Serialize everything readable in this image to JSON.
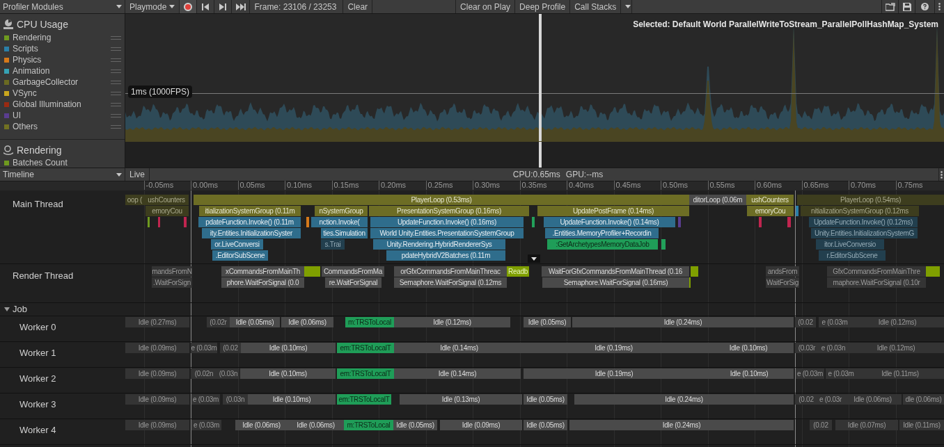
{
  "toolbar": {
    "modules_dropdown": "Profiler Modules",
    "target": "Playmode",
    "recording": true,
    "frame": "Frame: 23106 / 23253",
    "clear": "Clear",
    "options": [
      "Clear on Play",
      "Deep Profile",
      "Call Stacks"
    ]
  },
  "modules": [
    {
      "title": "CPU Usage",
      "series": [
        {
          "name": "Rendering",
          "color": "#6f9a1f"
        },
        {
          "name": "Scripts",
          "color": "#2b7fa8"
        },
        {
          "name": "Physics",
          "color": "#d6791a"
        },
        {
          "name": "Animation",
          "color": "#36a2b5"
        },
        {
          "name": "GarbageCollector",
          "color": "#6b6b22"
        },
        {
          "name": "VSync",
          "color": "#c9a71e"
        },
        {
          "name": "Global Illumination",
          "color": "#9a2a12"
        },
        {
          "name": "UI",
          "color": "#5a3d8f"
        },
        {
          "name": "Others",
          "color": "#717122"
        }
      ]
    },
    {
      "title": "Rendering",
      "series": [
        {
          "name": "Batches Count",
          "color": "#6f9a1f"
        }
      ]
    }
  ],
  "chart": {
    "threshold_label": "1ms (1000FPS)",
    "selected": "Selected: Default World ParallelWriteToStream_ParallelPollHashMap_System"
  },
  "timeline_bar": {
    "view": "Timeline",
    "mode": "Live",
    "cpu": "CPU:0.65ms",
    "gpu": "GPU:--ms"
  },
  "ticks": [
    "-0.05ms",
    "0.00ms",
    "0.05ms",
    "0.10ms",
    "0.15ms",
    "0.20ms",
    "0.25ms",
    "0.30ms",
    "0.35ms",
    "0.40ms",
    "0.45ms",
    "0.50ms",
    "0.55ms",
    "0.60ms",
    "0.65ms",
    "0.70ms",
    "0.75ms"
  ],
  "threads": [
    {
      "name": "Main Thread",
      "blocks": [
        {
          "text": "oop (",
          "kind": "player",
          "dimmed": true
        },
        {
          "text": "ushCounters",
          "kind": "player",
          "dimmed": true
        },
        {
          "text": "PlayerLoop (0.53ms)",
          "kind": "player",
          "dimmed": false
        },
        {
          "text": "ditorLoop (0.06m",
          "kind": "wait",
          "dimmed": false
        },
        {
          "text": "ushCounters",
          "kind": "player",
          "dimmed": false
        },
        {
          "text": "PlayerLoop (0.54ms)",
          "kind": "player",
          "dimmed": true
        },
        {
          "text": "emoryCou",
          "kind": "player",
          "dimmed": true
        },
        {
          "text": "itializationSystemGroup (0.11m",
          "kind": "player",
          "dimmed": false
        },
        {
          "text": "nSystemGroup",
          "kind": "player",
          "dimmed": false
        },
        {
          "text": "PresentationSystemGroup (0.16ms)",
          "kind": "player",
          "dimmed": false
        },
        {
          "text": "UpdatePostFrame (0.14ms)",
          "kind": "player",
          "dimmed": false
        },
        {
          "text": "emoryCou",
          "kind": "player",
          "dimmed": false
        },
        {
          "text": "nitializationSystemGroup (0.12ms",
          "kind": "player",
          "dimmed": true
        },
        {
          "text": "pdateFunction.Invoke() (0.11m",
          "kind": "script",
          "dimmed": false
        },
        {
          "text": "nction.Invoke(",
          "kind": "script",
          "dimmed": false
        },
        {
          "text": "UpdateFunction.Invoke() (0.16ms)",
          "kind": "script",
          "dimmed": false
        },
        {
          "text": "UpdateFunction.Invoke() (0.14ms)",
          "kind": "script",
          "dimmed": false
        },
        {
          "text": "UpdateFunction.Invoke() (0.12ms)",
          "kind": "script",
          "dimmed": true
        },
        {
          "text": "ity.Entities.InitializationSyster",
          "kind": "script",
          "dimmed": false
        },
        {
          "text": "ties.Simulation",
          "kind": "script",
          "dimmed": false
        },
        {
          "text": "World Unity.Entities.PresentationSystemGroup",
          "kind": "script",
          "dimmed": false
        },
        {
          "text": ".Entities.MemoryProfiler+Recordin",
          "kind": "script",
          "dimmed": false
        },
        {
          "text": "Unity.Entities.InitializationSystemG",
          "kind": "script",
          "dimmed": true
        },
        {
          "text": "or.LiveConversi",
          "kind": "script",
          "dimmed": false
        },
        {
          "text": "s.Trai",
          "kind": "script",
          "dimmed": true
        },
        {
          "text": "Unity.Rendering.HybridRendererSys",
          "kind": "script",
          "dimmed": false
        },
        {
          "text": ":GetArchetypesMemoryDataJob",
          "kind": "job",
          "dimmed": false
        },
        {
          "text": "itor.LiveConversio",
          "kind": "script",
          "dimmed": true
        },
        {
          "text": ".EditorSubScene",
          "kind": "script",
          "dimmed": false
        },
        {
          "text": "pdateHybridV2Batches (0.11m",
          "kind": "script",
          "dimmed": false
        },
        {
          "text": "r.EditorSubScene",
          "kind": "script",
          "dimmed": true
        }
      ]
    },
    {
      "name": "Render Thread",
      "blocks": [
        {
          "text": "mandsFromN",
          "kind": "wait",
          "dimmed": true
        },
        {
          "text": "xCommandsFromMainTh",
          "kind": "wait",
          "dimmed": false
        },
        {
          "text": "CommandsFromMa",
          "kind": "wait",
          "dimmed": false
        },
        {
          "text": "orGfxCommandsFromMainThreac",
          "kind": "wait",
          "dimmed": false
        },
        {
          "text": "Readb",
          "kind": "gpu",
          "dimmed": false
        },
        {
          "text": "WaitForGfxCommandsFromMainThread (0.16",
          "kind": "wait",
          "dimmed": false
        },
        {
          "text": "andsFrom",
          "kind": "wait",
          "dimmed": true
        },
        {
          "text": "GfxCommandsFromMainThre",
          "kind": "wait",
          "dimmed": true
        },
        {
          "text": ".WaitForSign",
          "kind": "wait",
          "dimmed": true
        },
        {
          "text": "phore.WaitForSignal (0.0",
          "kind": "wait",
          "dimmed": false
        },
        {
          "text": "re.WaitForSignal",
          "kind": "wait",
          "dimmed": false
        },
        {
          "text": "Semaphore.WaitForSignal (0.12ms",
          "kind": "wait",
          "dimmed": false
        },
        {
          "text": "Semaphore.WaitForSignal (0.16ms)",
          "kind": "wait",
          "dimmed": false
        },
        {
          "text": "WaitForSig",
          "kind": "wait",
          "dimmed": true
        },
        {
          "text": "maphore.WaitForSignal (0.10r",
          "kind": "wait",
          "dimmed": true
        }
      ]
    },
    {
      "name": "Job",
      "expanded": true,
      "children": [
        {
          "name": "Worker 0",
          "blocks": [
            {
              "text": "Idle (0.27ms)",
              "kind": "wait",
              "dimmed": true
            },
            {
              "text": "(0.02r",
              "kind": "wait",
              "dimmed": true
            },
            {
              "text": "Idle (0.05ms)",
              "kind": "wait",
              "dimmed": false
            },
            {
              "text": "Idle (0.06ms)",
              "kind": "wait",
              "dimmed": false
            },
            {
              "text": "m:TRSToLocal",
              "kind": "job",
              "dimmed": false
            },
            {
              "text": "Idle (0.12ms)",
              "kind": "wait",
              "dimmed": false
            },
            {
              "text": "Idle (0.05ms)",
              "kind": "wait",
              "dimmed": false
            },
            {
              "text": "Idle (0.24ms)",
              "kind": "wait",
              "dimmed": false
            },
            {
              "text": "(0.02",
              "kind": "wait",
              "dimmed": true
            },
            {
              "text": "e (0.03m",
              "kind": "wait",
              "dimmed": true
            },
            {
              "text": "Idle (0.12ms)",
              "kind": "wait",
              "dimmed": true
            }
          ]
        },
        {
          "name": "Worker 1",
          "blocks": [
            {
              "text": "Idle (0.09ms)",
              "kind": "wait",
              "dimmed": true
            },
            {
              "text": "e (0.03m",
              "kind": "wait",
              "dimmed": true
            },
            {
              "text": "(0.02",
              "kind": "wait",
              "dimmed": true
            },
            {
              "text": "Idle (0.10ms)",
              "kind": "wait",
              "dimmed": false
            },
            {
              "text": "em:TRSToLocalT",
              "kind": "job",
              "dimmed": false
            },
            {
              "text": "Idle (0.14ms)",
              "kind": "wait",
              "dimmed": false
            },
            {
              "text": "Idle (0.19ms)",
              "kind": "wait",
              "dimmed": false
            },
            {
              "text": "Idle (0.10ms)",
              "kind": "wait",
              "dimmed": false
            },
            {
              "text": "(0.03r",
              "kind": "wait",
              "dimmed": true
            },
            {
              "text": "e (0.03n",
              "kind": "wait",
              "dimmed": true
            },
            {
              "text": "Idle (0.12ms)",
              "kind": "wait",
              "dimmed": true
            }
          ]
        },
        {
          "name": "Worker 2",
          "blocks": [
            {
              "text": "Idle (0.09ms)",
              "kind": "wait",
              "dimmed": true
            },
            {
              "text": "(0.02n",
              "kind": "wait",
              "dimmed": true
            },
            {
              "text": "(0.03n",
              "kind": "wait",
              "dimmed": true
            },
            {
              "text": "Idle (0.10ms)",
              "kind": "wait",
              "dimmed": false
            },
            {
              "text": "em:TRSToLocalT",
              "kind": "job",
              "dimmed": false
            },
            {
              "text": "Idle (0.14ms)",
              "kind": "wait",
              "dimmed": false
            },
            {
              "text": "Idle (0.19ms)",
              "kind": "wait",
              "dimmed": false
            },
            {
              "text": "Idle (0.10ms)",
              "kind": "wait",
              "dimmed": false
            },
            {
              "text": "e (0.03m",
              "kind": "wait",
              "dimmed": true
            },
            {
              "text": "e (0.03m",
              "kind": "wait",
              "dimmed": true
            },
            {
              "text": "Idle (0.11ms)",
              "kind": "wait",
              "dimmed": true
            }
          ]
        },
        {
          "name": "Worker 3",
          "blocks": [
            {
              "text": "Idle (0.09ms)",
              "kind": "wait",
              "dimmed": true
            },
            {
              "text": "e (0.03m",
              "kind": "wait",
              "dimmed": true
            },
            {
              "text": "(0.03n",
              "kind": "wait",
              "dimmed": true
            },
            {
              "text": "Idle (0.10ms)",
              "kind": "wait",
              "dimmed": false
            },
            {
              "text": "em:TRSToLocalT",
              "kind": "job",
              "dimmed": false
            },
            {
              "text": "Idle (0.13ms)",
              "kind": "wait",
              "dimmed": false
            },
            {
              "text": "Idle (0.05ms)",
              "kind": "wait",
              "dimmed": false
            },
            {
              "text": "Idle (0.24ms)",
              "kind": "wait",
              "dimmed": false
            },
            {
              "text": "(0.02",
              "kind": "wait",
              "dimmed": true
            },
            {
              "text": "e (0.03r",
              "kind": "wait",
              "dimmed": true
            },
            {
              "text": "Idle (0.06ms)",
              "kind": "wait",
              "dimmed": true
            },
            {
              "text": "dle (0.06ms)",
              "kind": "wait",
              "dimmed": true
            }
          ]
        },
        {
          "name": "Worker 4",
          "blocks": [
            {
              "text": "Idle (0.09ms)",
              "kind": "wait",
              "dimmed": true
            },
            {
              "text": "e (0.03m",
              "kind": "wait",
              "dimmed": true
            },
            {
              "text": "Idle (0.06ms)",
              "kind": "wait",
              "dimmed": false
            },
            {
              "text": "Idle (0.06ms)",
              "kind": "wait",
              "dimmed": false
            },
            {
              "text": "m:TRSToLocal",
              "kind": "job",
              "dimmed": false
            },
            {
              "text": "Idle (0.05ms)",
              "kind": "wait",
              "dimmed": false
            },
            {
              "text": "Idle (0.09ms)",
              "kind": "wait",
              "dimmed": false
            },
            {
              "text": "Idle (0.05ms)",
              "kind": "wait",
              "dimmed": false
            },
            {
              "text": "Idle (0.24ms)",
              "kind": "wait",
              "dimmed": false
            },
            {
              "text": "(0.02",
              "kind": "wait",
              "dimmed": true
            },
            {
              "text": "Idle (0.07ms)",
              "kind": "wait",
              "dimmed": true
            },
            {
              "text": "Idle (0.11ms)",
              "kind": "wait",
              "dimmed": true
            }
          ]
        }
      ]
    }
  ]
}
